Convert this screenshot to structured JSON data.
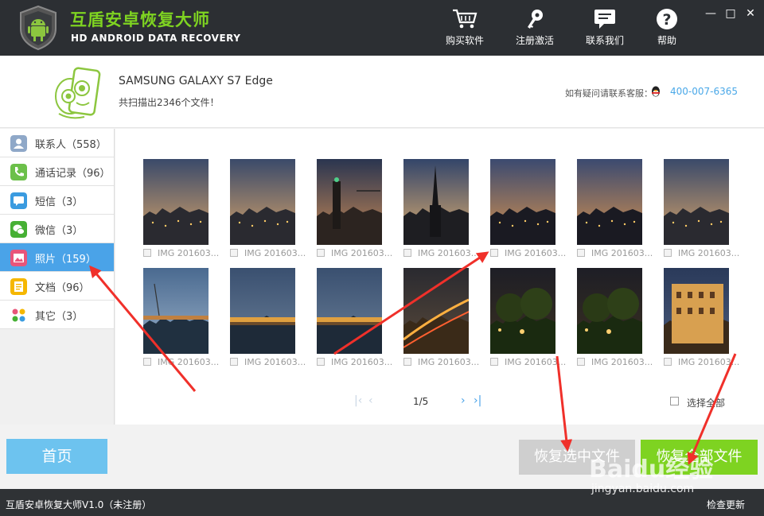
{
  "header": {
    "app_title": "互盾安卓恢复大师",
    "app_subtitle": "HD ANDROID DATA RECOVERY",
    "nav": [
      {
        "label": "购买软件",
        "icon": "cart-icon"
      },
      {
        "label": "注册激活",
        "icon": "key-icon"
      },
      {
        "label": "联系我们",
        "icon": "chat-icon"
      },
      {
        "label": "帮助",
        "icon": "help-icon"
      }
    ],
    "window_controls": {
      "minimize": "—",
      "maximize": "□",
      "close": "✕"
    }
  },
  "device": {
    "name": "SAMSUNG  GALAXY S7 Edge",
    "scan_result": "共扫描出2346个文件！",
    "support_label": "如有疑问请联系客服：",
    "support_phone": "400-007-6365"
  },
  "categories": [
    {
      "label": "联系人（558）",
      "icon": "contacts-icon",
      "color": "#8fa8c8"
    },
    {
      "label": "通话记录（96）",
      "icon": "phone-icon",
      "color": "#6cc04a"
    },
    {
      "label": "短信（3）",
      "icon": "sms-icon",
      "color": "#3a9be0"
    },
    {
      "label": "微信（3）",
      "icon": "wechat-icon",
      "color": "#46b034"
    },
    {
      "label": "照片（159）",
      "icon": "photo-icon",
      "color": "#e8557a",
      "active": true
    },
    {
      "label": "文档（96）",
      "icon": "document-icon",
      "color": "#f5b700"
    },
    {
      "label": "其它（3）",
      "icon": "other-icon",
      "color": "#e8557a"
    }
  ],
  "photos": [
    {
      "caption": "IMG 201603...",
      "scene": "dusk-city"
    },
    {
      "caption": "IMG 201603...",
      "scene": "dusk-city"
    },
    {
      "caption": "IMG 201603...",
      "scene": "tower-crane"
    },
    {
      "caption": "IMG 201603...",
      "scene": "church-spire"
    },
    {
      "caption": "IMG 201603...",
      "scene": "city-lights"
    },
    {
      "caption": "IMG 201603...",
      "scene": "city-lights"
    },
    {
      "caption": "IMG 201603...",
      "scene": "dusk-city"
    },
    {
      "caption": "IMG 201603...",
      "scene": "harbor"
    },
    {
      "caption": "IMG 201603...",
      "scene": "bridge"
    },
    {
      "caption": "IMG 201603...",
      "scene": "bridge"
    },
    {
      "caption": "IMG 201603...",
      "scene": "street-trails"
    },
    {
      "caption": "IMG 201603...",
      "scene": "trees-night"
    },
    {
      "caption": "IMG 201603...",
      "scene": "trees-night"
    },
    {
      "caption": "IMG 201603...",
      "scene": "building"
    }
  ],
  "pagination": {
    "page_text": "1/5"
  },
  "select_all_label": "选择全部",
  "buttons": {
    "home": "首页",
    "recover_selected": "恢复选中文件",
    "recover_all": "恢复全部文件"
  },
  "status_bar": {
    "version": "互盾安卓恢复大师V1.0（未注册）",
    "check_update": "检查更新"
  },
  "watermark": {
    "logo": "Baidu经验",
    "url": "jingyan.baidu.com"
  },
  "colors": {
    "accent_green": "#7ed321",
    "accent_blue": "#4aa3e8",
    "header_bg": "#2c2f33"
  }
}
